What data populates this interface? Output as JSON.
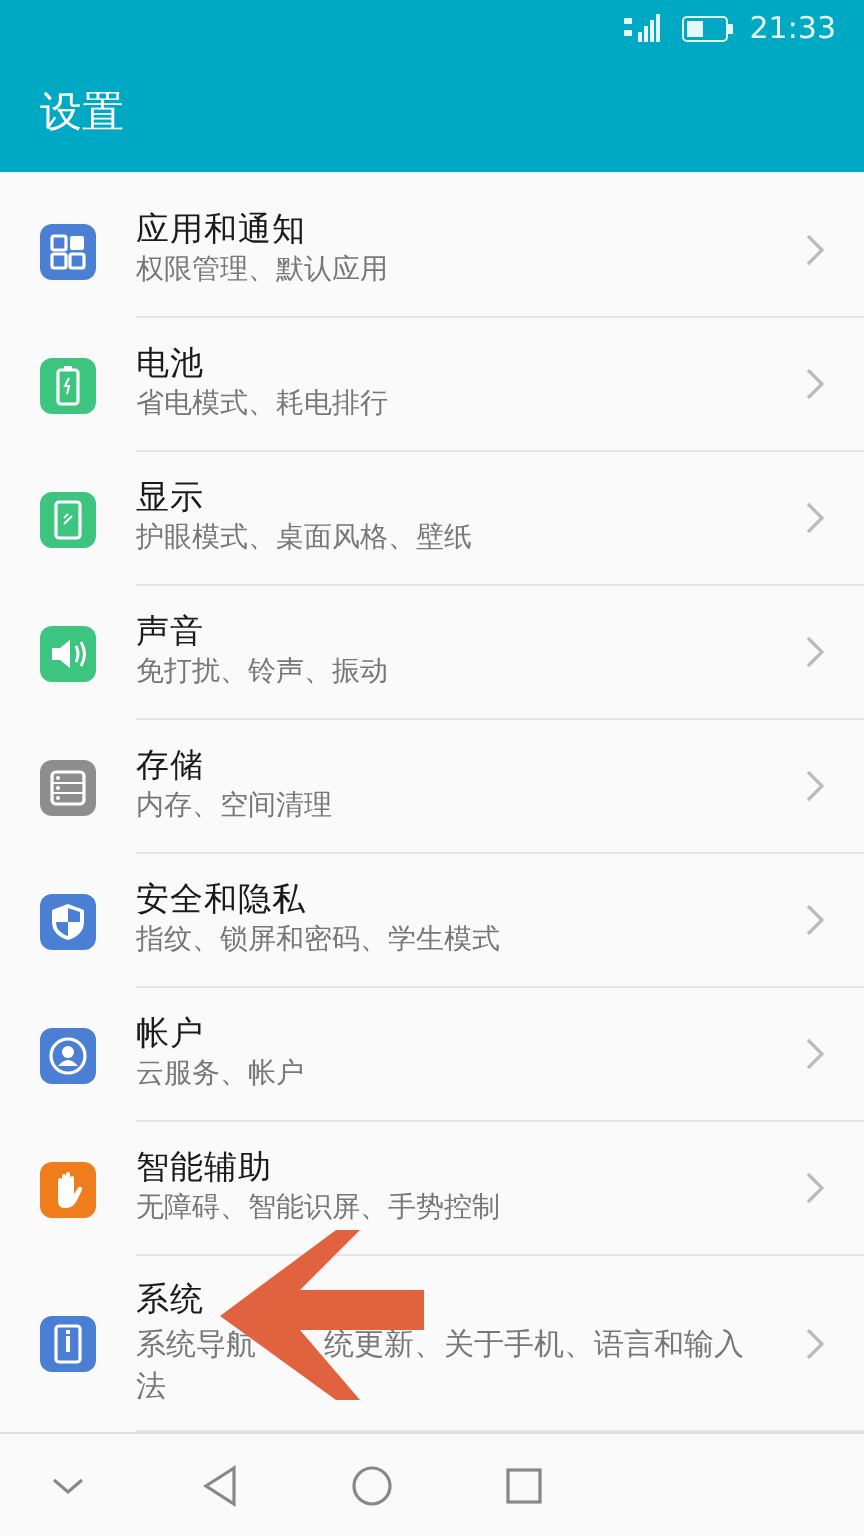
{
  "status_bar": {
    "time": "21:33"
  },
  "app_bar": {
    "title": "设置"
  },
  "items": [
    {
      "title": "应用和通知",
      "subtitle": "权限管理、默认应用"
    },
    {
      "title": "电池",
      "subtitle": "省电模式、耗电排行"
    },
    {
      "title": "显示",
      "subtitle": "护眼模式、桌面风格、壁纸"
    },
    {
      "title": "声音",
      "subtitle": "免打扰、铃声、振动"
    },
    {
      "title": "存储",
      "subtitle": "内存、空间清理"
    },
    {
      "title": "安全和隐私",
      "subtitle": "指纹、锁屏和密码、学生模式"
    },
    {
      "title": "帐户",
      "subtitle": "云服务、帐户"
    },
    {
      "title": "智能辅助",
      "subtitle": "无障碍、智能识屏、手势控制"
    },
    {
      "title": "系统",
      "subtitle_parts": [
        "系统导航",
        "统更新、关于手机、语言和输入法"
      ],
      "annotation": {
        "kind": "arrow"
      }
    }
  ]
}
